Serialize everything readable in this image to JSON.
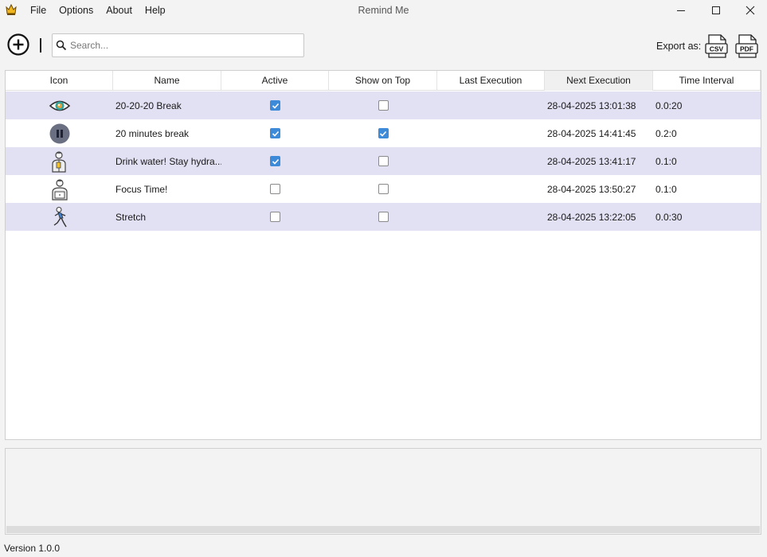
{
  "app": {
    "title": "Remind Me",
    "icon": "app-crown-icon"
  },
  "menu": [
    {
      "label": "File"
    },
    {
      "label": "Options"
    },
    {
      "label": "About"
    },
    {
      "label": "Help"
    }
  ],
  "toolbar": {
    "add_icon": "plus-circle-icon",
    "search_placeholder": "Search...",
    "search_value": "",
    "export_label": "Export as:",
    "export_csv_label": "CSV",
    "export_pdf_label": "PDF"
  },
  "table": {
    "columns": [
      "Icon",
      "Name",
      "Active",
      "Show on Top",
      "Last Execution",
      "Next Execution",
      "Time Interval"
    ],
    "sorted_column": "Next Execution",
    "rows": [
      {
        "icon": "eye-icon",
        "name": "20-20-20 Break",
        "active": true,
        "show_on_top": false,
        "last_execution": "",
        "next_execution": "28-04-2025 13:01:38",
        "interval": "0.0:20"
      },
      {
        "icon": "pause-icon",
        "name": "20 minutes break",
        "active": true,
        "show_on_top": true,
        "last_execution": "",
        "next_execution": "28-04-2025 14:41:45",
        "interval": "0.2:0"
      },
      {
        "icon": "person-drinking-icon",
        "name": "Drink water! Stay hydra...",
        "active": true,
        "show_on_top": false,
        "last_execution": "",
        "next_execution": "28-04-2025 13:41:17",
        "interval": "0.1:0"
      },
      {
        "icon": "person-laptop-icon",
        "name": "Focus Time!",
        "active": false,
        "show_on_top": false,
        "last_execution": "",
        "next_execution": "28-04-2025 13:50:27",
        "interval": "0.1:0"
      },
      {
        "icon": "person-running-icon",
        "name": "Stretch",
        "active": false,
        "show_on_top": false,
        "last_execution": "",
        "next_execution": "28-04-2025 13:22:05",
        "interval": "0.0:30"
      }
    ]
  },
  "status": {
    "version": "Version 1.0.0"
  },
  "colors": {
    "row_alt": "#e2e0f3",
    "checkbox_on": "#3c8ad8"
  }
}
